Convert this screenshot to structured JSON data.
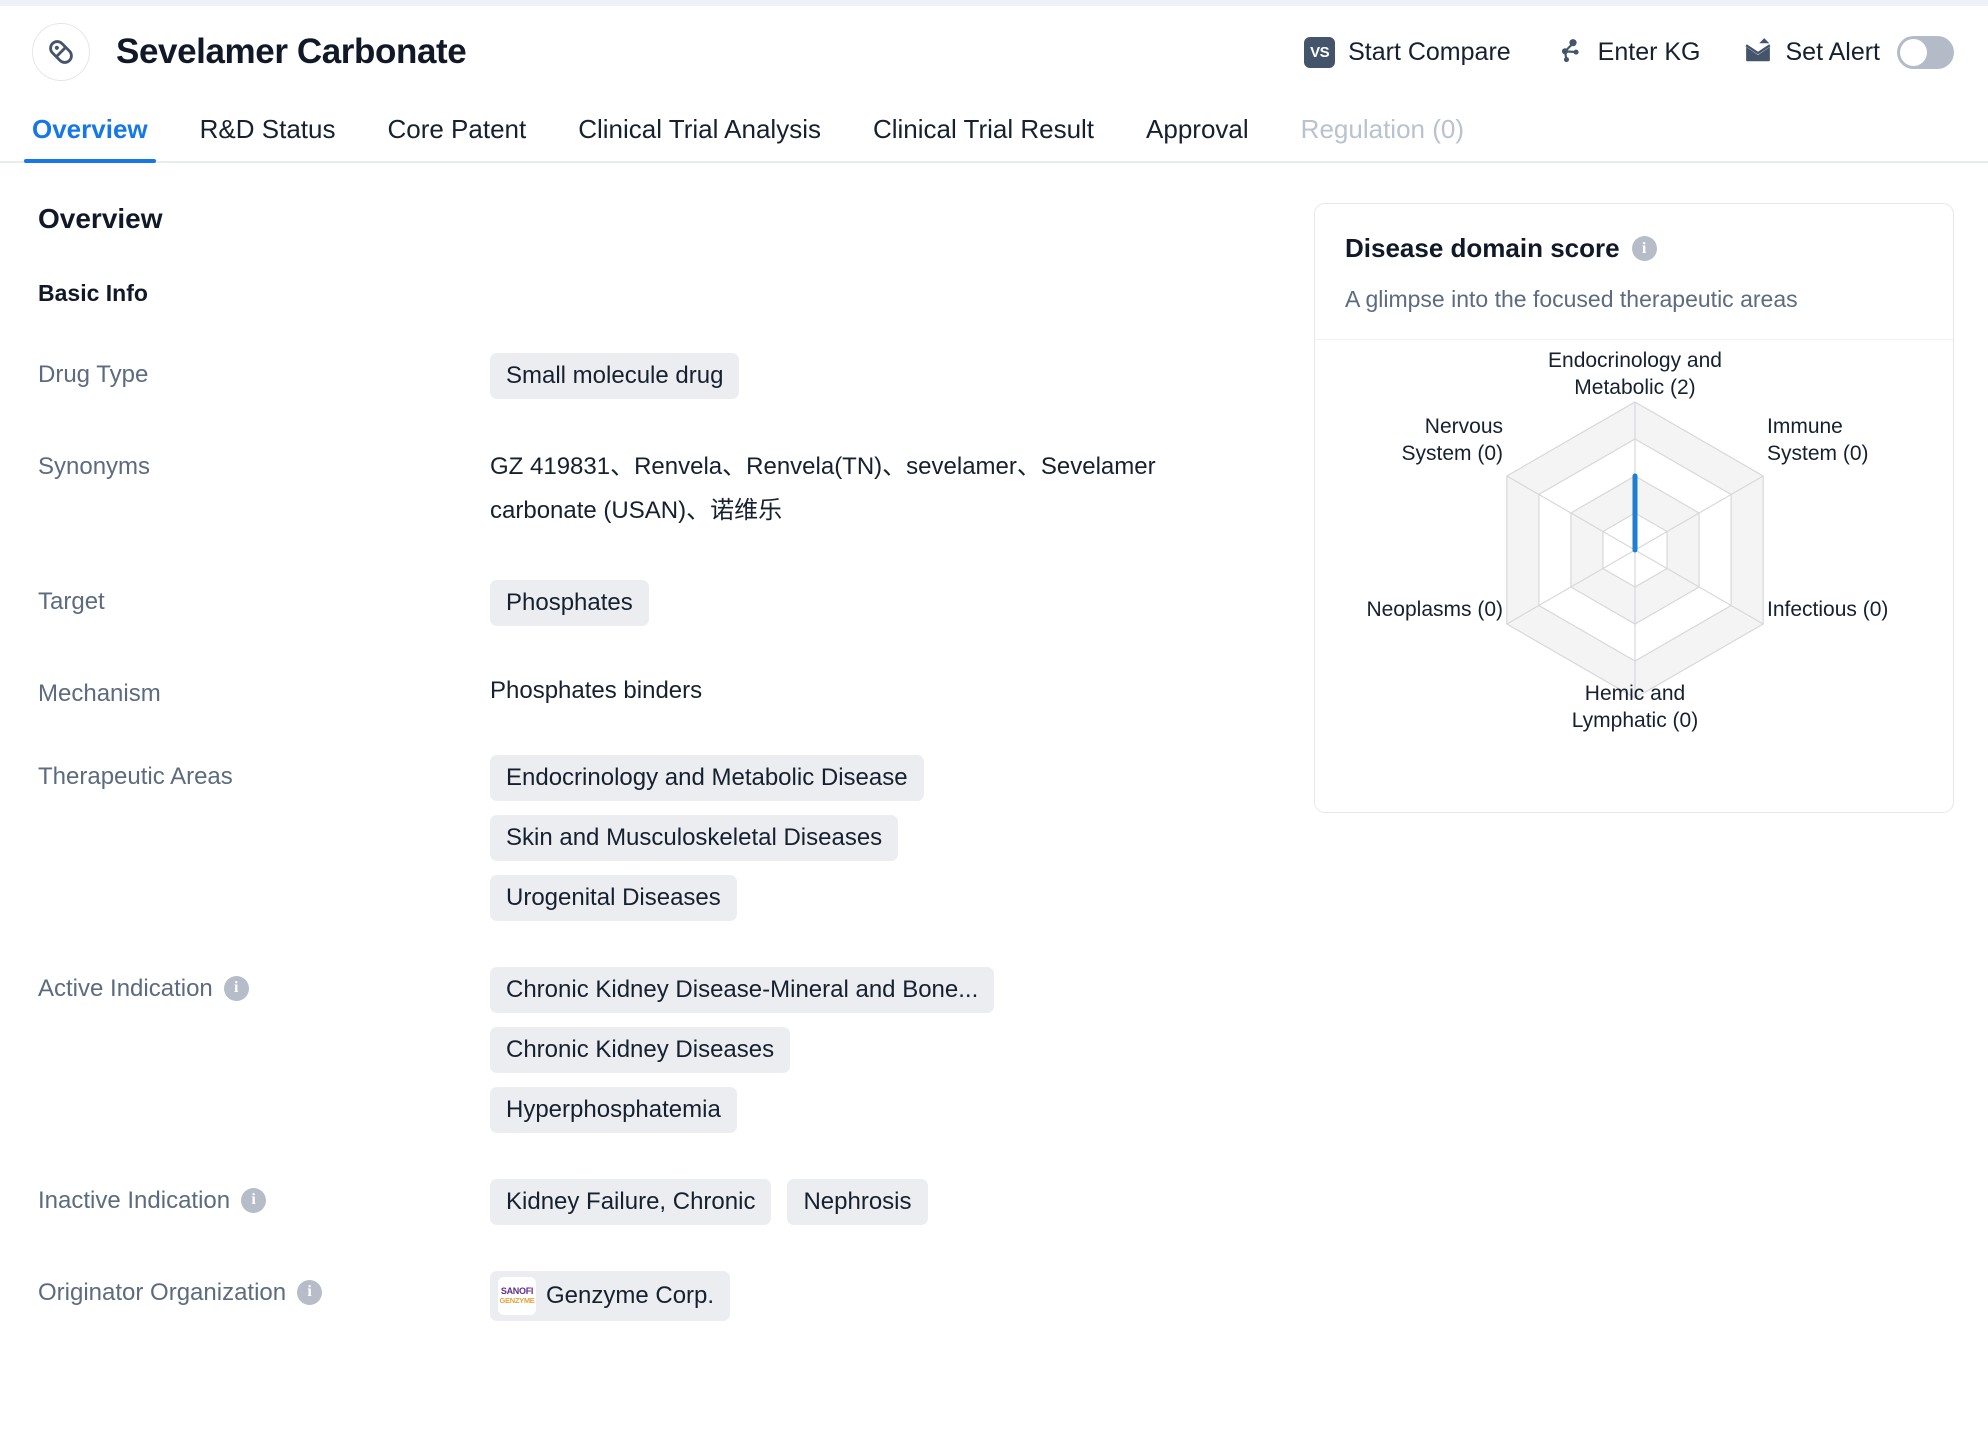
{
  "header": {
    "drug_name": "Sevelamer Carbonate",
    "pill_icon": "capsule-icon",
    "actions": [
      {
        "id": "start-compare",
        "label": "Start Compare",
        "icon": "vs-badge-icon",
        "badge_text": "VS"
      },
      {
        "id": "enter-kg",
        "label": "Enter KG",
        "icon": "knowledge-graph-icon"
      },
      {
        "id": "set-alert",
        "label": "Set Alert",
        "icon": "alert-envelope-icon"
      }
    ],
    "alert_toggle_state": "off"
  },
  "tabs": [
    {
      "label": "Overview",
      "active": true,
      "disabled": false
    },
    {
      "label": "R&D Status",
      "active": false,
      "disabled": false
    },
    {
      "label": "Core Patent",
      "active": false,
      "disabled": false
    },
    {
      "label": "Clinical Trial Analysis",
      "active": false,
      "disabled": false
    },
    {
      "label": "Clinical Trial Result",
      "active": false,
      "disabled": false
    },
    {
      "label": "Approval",
      "active": false,
      "disabled": false
    },
    {
      "label": "Regulation (0)",
      "active": false,
      "disabled": true
    }
  ],
  "main": {
    "page_heading": "Overview",
    "basic_info_heading": "Basic Info",
    "fields": {
      "drug_type": {
        "label": "Drug Type",
        "chips": [
          "Small molecule drug"
        ]
      },
      "synonyms": {
        "label": "Synonyms",
        "text": "GZ 419831、Renvela、Renvela(TN)、sevelamer、Sevelamer carbonate (USAN)、诺维乐"
      },
      "target": {
        "label": "Target",
        "chips": [
          "Phosphates"
        ]
      },
      "mechanism": {
        "label": "Mechanism",
        "text": "Phosphates binders"
      },
      "therapeutic_areas": {
        "label": "Therapeutic Areas",
        "chips": [
          "Endocrinology and Metabolic Disease",
          "Skin and Musculoskeletal Diseases",
          "Urogenital Diseases"
        ]
      },
      "active_indication": {
        "label": "Active Indication",
        "has_info": true,
        "chips": [
          "Chronic Kidney Disease-Mineral and Bone...",
          "Chronic Kidney Diseases",
          "Hyperphosphatemia"
        ]
      },
      "inactive_indication": {
        "label": "Inactive Indication",
        "has_info": true,
        "chips": [
          "Kidney Failure, Chronic",
          "Nephrosis"
        ]
      },
      "originator_organization": {
        "label": "Originator Organization",
        "has_info": true,
        "company": "Genzyme Corp.",
        "logo_line1": "SANOFI",
        "logo_line2": "GENZYME"
      }
    }
  },
  "score_card": {
    "title": "Disease domain score",
    "subtitle": "A glimpse into the focused therapeutic areas",
    "has_info": true
  },
  "chart_data": {
    "type": "radar",
    "title": "Disease domain score",
    "subtitle": "A glimpse into the focused therapeutic areas",
    "categories": [
      "Endocrinology and\nMetabolic (2)",
      "Immune\nSystem (0)",
      "Infectious (0)",
      "Hemic and\nLymphatic (0)",
      "Neoplasms (0)",
      "Nervous\nSystem (0)"
    ],
    "axis_names": [
      "Endocrinology and Metabolic",
      "Immune System",
      "Infectious",
      "Hemic and Lymphatic",
      "Neoplasms",
      "Nervous System"
    ],
    "values": [
      2,
      0,
      0,
      0,
      0,
      0
    ],
    "rlim": [
      0,
      4
    ],
    "rings": 4,
    "grid": true,
    "legend": "none",
    "series_color": "#1f7ed0",
    "grid_color": "#d6d8db",
    "band_color": "#f4f4f5"
  },
  "colors": {
    "accent": "#1677e8",
    "series": "#1f7ed0",
    "label_text": "#5d6b7e",
    "chip_bg": "#ebedf1",
    "dark": "#16202e"
  }
}
